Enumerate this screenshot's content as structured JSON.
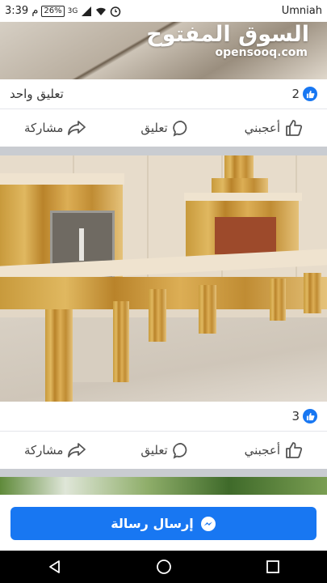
{
  "status_bar": {
    "time": "3:39 م",
    "battery": "26%",
    "network": "3G",
    "carrier": "Umniah"
  },
  "post1": {
    "logo_ar": "السوق المفتوح",
    "logo_en": "opensooq.com",
    "comment_count": "تعليق واحد",
    "likes": "2"
  },
  "post2": {
    "likes": "3"
  },
  "actions": {
    "like": "أعجبني",
    "comment": "تعليق",
    "share": "مشاركة"
  },
  "message_button": {
    "label": "إرسال رسالة"
  },
  "colors": {
    "accent": "#1877f2",
    "divider": "#c9ccd1"
  },
  "icons": [
    "like-icon",
    "comment-icon",
    "share-icon",
    "messenger-icon",
    "back-icon",
    "home-icon",
    "recents-icon"
  ]
}
